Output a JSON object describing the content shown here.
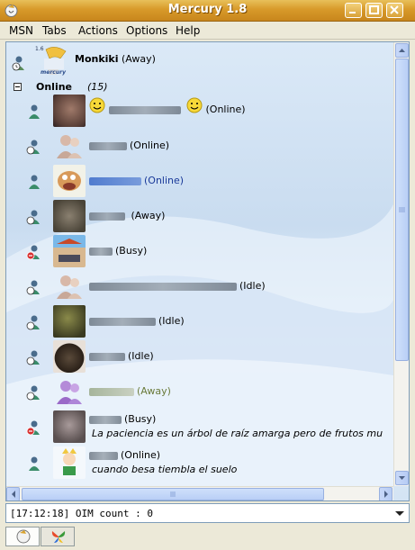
{
  "window": {
    "title": "Mercury 1.8",
    "accent": "#d89a2a",
    "buttons": [
      "minimize-icon",
      "maximize-icon",
      "close-icon"
    ]
  },
  "menu": [
    "MSN",
    "Tabs",
    "Actions",
    "Options",
    "Help"
  ],
  "self": {
    "name": "Monkiki",
    "status": "(Away)",
    "avatar_label_small": "1.6",
    "avatar_label": "mercury"
  },
  "group": {
    "label": "Online",
    "count": "(15)",
    "toggle": "minus-icon"
  },
  "contacts": [
    {
      "status": "(Online)",
      "state": "online",
      "psm": ""
    },
    {
      "status": "(Online)",
      "state": "away",
      "psm": ""
    },
    {
      "status": "(Online)",
      "state": "online",
      "psm": ""
    },
    {
      "status": "(Away)",
      "state": "away",
      "psm": ""
    },
    {
      "status": "(Busy)",
      "state": "busy",
      "psm": ""
    },
    {
      "status": "(Idle)",
      "state": "away",
      "psm": ""
    },
    {
      "status": "(Idle)",
      "state": "away",
      "psm": ""
    },
    {
      "status": "(Idle)",
      "state": "away",
      "psm": ""
    },
    {
      "status": "(Away)",
      "state": "away",
      "psm": ""
    },
    {
      "status": "(Busy)",
      "state": "busy",
      "psm": "La paciencia es un árbol de raíz amarga pero de frutos mu"
    },
    {
      "status": "(Online)",
      "state": "online",
      "psm": "cuando besa tiembla el suelo"
    }
  ],
  "status_bar": {
    "text": "[17:12:18] OIM count : 0"
  },
  "tabs": [
    "contacts-tab-icon",
    "msn-butterfly-icon"
  ]
}
